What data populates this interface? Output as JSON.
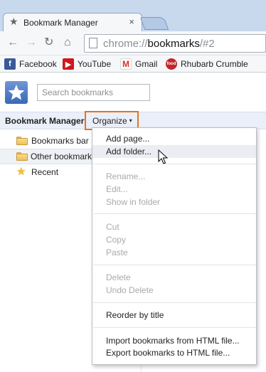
{
  "browser": {
    "tab": {
      "title": "Bookmark Manager",
      "close_glyph": "×",
      "favicon": "star-icon"
    },
    "toolbar": {
      "back_glyph": "←",
      "forward_glyph": "→",
      "reload_glyph": "↻",
      "home_glyph": "⌂"
    },
    "omnibox": {
      "scheme": "chrome://",
      "host": "bookmarks",
      "path": "/#2"
    },
    "bookmarks_bar": [
      {
        "label": "Facebook",
        "icon": "facebook-icon",
        "glyph": "f"
      },
      {
        "label": "YouTube",
        "icon": "youtube-icon",
        "glyph": "▶"
      },
      {
        "label": "Gmail",
        "icon": "gmail-icon",
        "glyph": "M"
      },
      {
        "label": "Rhubarb Crumble",
        "icon": "food-icon",
        "glyph": "food"
      }
    ]
  },
  "manager": {
    "search_placeholder": "Search bookmarks",
    "header_title": "Bookmark Manager",
    "organize_label": "Organize",
    "organize_caret": "▾",
    "tree": [
      {
        "label": "Bookmarks bar",
        "icon": "folder-icon"
      },
      {
        "label": "Other bookmarks",
        "icon": "folder-icon",
        "selected": true
      },
      {
        "label": "Recent",
        "icon": "star-icon"
      }
    ]
  },
  "menu": {
    "items": [
      {
        "label": "Add page...",
        "enabled": true
      },
      {
        "label": "Add folder...",
        "enabled": true,
        "hovered": true
      },
      {
        "label": "Rename...",
        "enabled": false
      },
      {
        "label": "Edit...",
        "enabled": false
      },
      {
        "label": "Show in folder",
        "enabled": false
      },
      {
        "label": "Cut",
        "enabled": false
      },
      {
        "label": "Copy",
        "enabled": false
      },
      {
        "label": "Paste",
        "enabled": false
      },
      {
        "label": "Delete",
        "enabled": false
      },
      {
        "label": "Undo Delete",
        "enabled": false
      },
      {
        "label": "Reorder by title",
        "enabled": true
      },
      {
        "label": "Import bookmarks from HTML file...",
        "enabled": true
      },
      {
        "label": "Export bookmarks to HTML file...",
        "enabled": true
      }
    ]
  },
  "colors": {
    "highlight_border": "#e3741d",
    "header_bar": "#ebeff9",
    "disabled_text": "#a9a9a9"
  }
}
